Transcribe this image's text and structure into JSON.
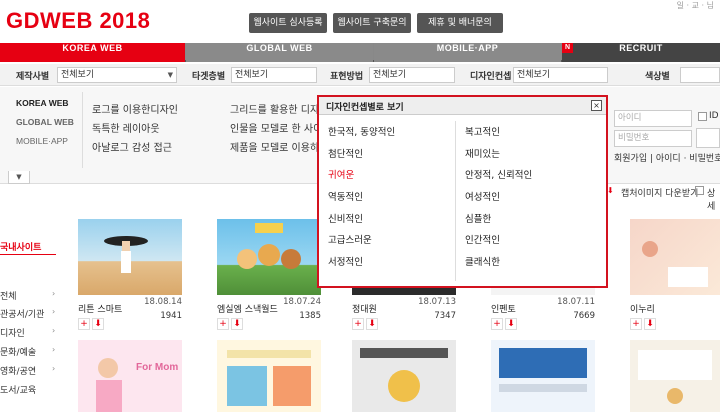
{
  "brand": {
    "logo": "GDWEB 2018",
    "accent": "#e60012"
  },
  "top_buttons": [
    "웹사이트 심사등록",
    "웹사이트 구축문의",
    "제휴 및 배너문의"
  ],
  "top_links": "일 · 교 · 님",
  "nav_tabs": [
    {
      "label": "KOREA WEB",
      "active": true
    },
    {
      "label": "GLOBAL WEB",
      "active": false
    },
    {
      "label": "MOBILE·APP",
      "active": false
    },
    {
      "label": "RECRUIT",
      "active": false,
      "badge": "N"
    }
  ],
  "filters": [
    {
      "label": "제작사별",
      "value": "전체보기"
    },
    {
      "label": "타겟층별",
      "value": "전체보기"
    },
    {
      "label": "표현방법",
      "value": "전체보기"
    },
    {
      "label": "디자인컨셉",
      "value": "전체보기"
    },
    {
      "label": "색상별",
      "value": ""
    }
  ],
  "left_nav": [
    "KOREA WEB",
    "GLOBAL WEB",
    "MOBILE·APP"
  ],
  "categories_col1": [
    "로그를 이용한디자인",
    "독특한 레이아웃",
    "아날로그 감성 접근"
  ],
  "categories_col2": [
    "그리드를 활용한 디자",
    "인물을 모델로 한 사이",
    "제품을 모델로 이용하"
  ],
  "modal": {
    "title": "디자인컨셉별로 보기",
    "close": "×",
    "col1": [
      "한국적, 동양적인",
      "첨단적인",
      "귀여운",
      "역동적인",
      "신비적인",
      "고급스러운",
      "서정적인"
    ],
    "col2": [
      "복고적인",
      "재미있는",
      "안정적, 신뢰적인",
      "여성적인",
      "심플한",
      "인간적인",
      "클래식한"
    ],
    "active": "귀여운"
  },
  "login": {
    "id_placeholder": "아이디",
    "pw_placeholder": "비밀번호",
    "id_save": "ID",
    "links": "회원가입 | 아이디 · 비밀번호"
  },
  "capture_download": "캡처이미지 다운받기",
  "detail": "상세",
  "side_title": "국내사이트",
  "side_items": [
    "전체",
    "관공서/기관",
    "디자인",
    "문화/예술",
    "영화/공연",
    "도서/교육"
  ],
  "cards": [
    {
      "title": "리튼 스마트",
      "date": "18.08.14",
      "count": "1941"
    },
    {
      "title": "엠실엠 스낵월드",
      "date": "18.07.24",
      "count": "1385"
    },
    {
      "title": "정대원",
      "date": "18.07.13",
      "count": "7347"
    },
    {
      "title": "인펜토",
      "date": "18.07.11",
      "count": "7669"
    },
    {
      "title": "이누리",
      "date": "",
      "count": ""
    }
  ],
  "card_row2_text": "For Mom"
}
